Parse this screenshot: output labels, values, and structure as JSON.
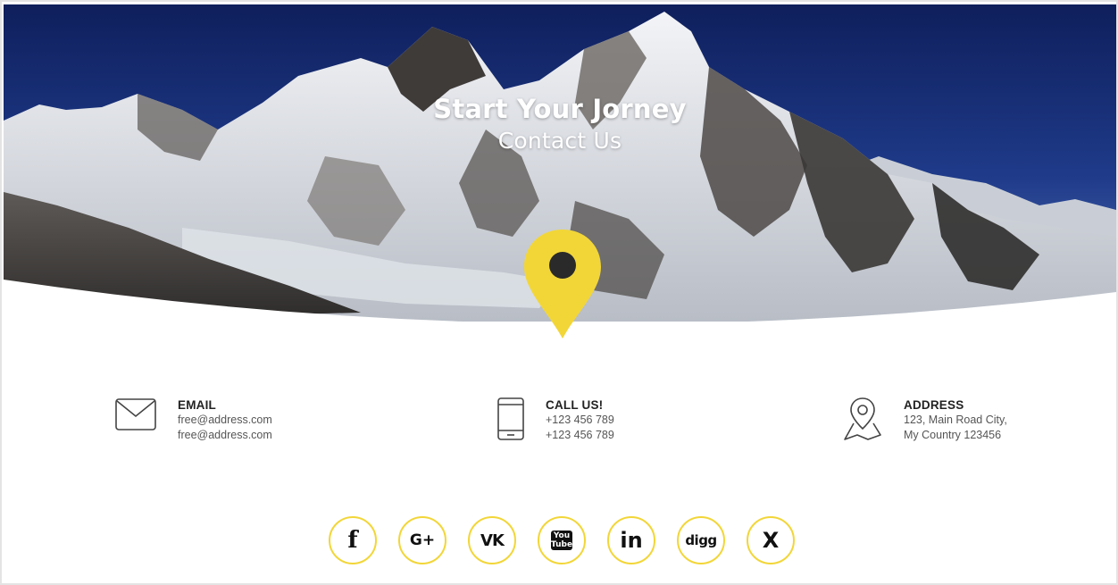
{
  "hero": {
    "title": "Start Your Jorney",
    "subtitle": "Contact Us"
  },
  "contacts": [
    {
      "icon": "envelope-icon",
      "label": "EMAIL",
      "lines": [
        "free@address.com",
        "free@address.com"
      ]
    },
    {
      "icon": "smartphone-icon",
      "label": "CALL US!",
      "lines": [
        "+123 456 789",
        "+123 456 789"
      ]
    },
    {
      "icon": "map-pin-icon",
      "label": "ADDRESS",
      "lines": [
        "123, Main Road City,",
        "My Country 123456"
      ]
    }
  ],
  "social": [
    {
      "icon": "facebook-icon",
      "glyph": "f"
    },
    {
      "icon": "google-plus-icon",
      "glyph": "G+"
    },
    {
      "icon": "vk-icon",
      "glyph": "VK"
    },
    {
      "icon": "youtube-icon",
      "glyph": "You Tube"
    },
    {
      "icon": "linkedin-icon",
      "glyph": "in"
    },
    {
      "icon": "digg-icon",
      "glyph": "digg"
    },
    {
      "icon": "x-icon",
      "glyph": "X"
    }
  ],
  "colors": {
    "accent": "#f2d638",
    "sky": "#1a2c6b",
    "text": "#333333"
  }
}
